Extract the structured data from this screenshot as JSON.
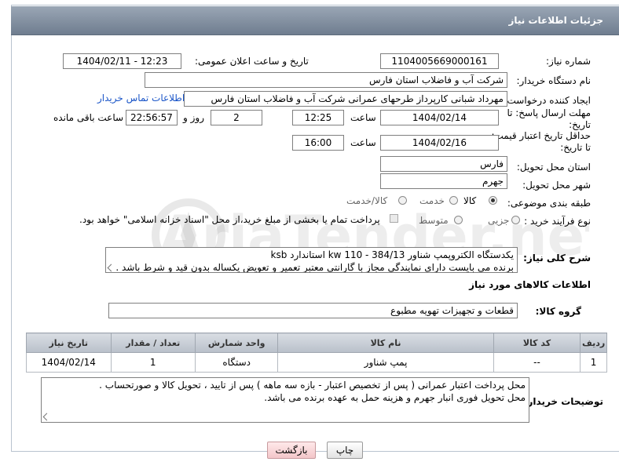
{
  "header": {
    "title": "جزئیات اطلاعات نیاز"
  },
  "fields": {
    "need_number": {
      "label": "شماره نیاز:",
      "value": "1104005669000161"
    },
    "announce_datetime": {
      "label": "تاریخ و ساعت اعلان عمومی:",
      "value": "1404/02/11 - 12:23"
    },
    "buyer_org": {
      "label": "نام دستگاه خریدار:",
      "value": "شرکت آب و فاضلاب استان فارس"
    },
    "requester": {
      "label": "ایجاد کننده درخواست:",
      "value": "مهرداد شبانی کارپرداز طرحهای عمرانی  شرکت آب و فاضلاب استان فارس",
      "contact_link": "اطلاعات تماس خریدار"
    },
    "reply_deadline": {
      "label_line1": "مهلت ارسال پاسخ: تا",
      "label_line2": "تاریخ:",
      "date": "1404/02/14",
      "time_label": "ساعت",
      "time": "12:25",
      "days": "2",
      "days_label": "روز و",
      "remaining": "22:56:57",
      "remaining_label": "ساعت باقی مانده"
    },
    "price_validity": {
      "label_line1": "حداقل تاریخ اعتبار قیمت:",
      "label_line2": "تا تاریخ:",
      "date": "1404/02/16",
      "time_label": "ساعت",
      "time": "16:00"
    },
    "delivery_province": {
      "label": "استان محل تحویل:",
      "value": "فارس"
    },
    "delivery_city": {
      "label": "شهر محل تحویل:",
      "value": "جهرم"
    },
    "category": {
      "label": "طبقه بندی موضوعی:",
      "options": [
        "کالا",
        "خدمت",
        "کالا/خدمت"
      ],
      "selected": "کالا"
    },
    "purchase_type": {
      "label": "نوع فرآیند خرید :",
      "options": [
        "جزیی",
        "متوسط"
      ],
      "payment_note": "پرداخت تمام یا بخشی از مبلغ خرید،از محل \"اسناد خزانه اسلامی\" خواهد بود."
    },
    "description": {
      "label": "شرح کلی نیاز:",
      "line1": "یکدستگاه الکتروپمپ شناور kw 110 - 384/13 استاندارد ksb",
      "line2": "برنده می بایست دارای نمایندگی مجاز با گارانتی معتبر تعمیر و تعویض یکساله بدون قید و شرط باشد ."
    }
  },
  "goods_info": {
    "section_title": "اطلاعات کالاهای مورد نیاز",
    "group_label": "گروه کالا:",
    "group_value": "قطعات و تجهیزات تهویه مطبوع",
    "columns": [
      "ردیف",
      "کد کالا",
      "نام کالا",
      "واحد شمارش",
      "تعداد / مقدار",
      "تاریخ نیاز"
    ],
    "rows": [
      {
        "row": "1",
        "code": "--",
        "name": "پمپ شناور",
        "unit": "دستگاه",
        "qty": "1",
        "date": "1404/02/14"
      }
    ]
  },
  "buyer_notes": {
    "label": "توضیحات خریدار:",
    "line1": "محل پرداخت اعتبار عمرانی  ( پس از تخصیص اعتبار  - بازه سه ماهه ) پس از تایید ، تحویل کالا و صورتحساب .",
    "line2": "محل تحویل فوری انبار جهرم و هزینه حمل به عهده برنده می باشد."
  },
  "buttons": {
    "print": "چاپ",
    "back": "بازگشت"
  },
  "watermark": {
    "text": "AriaTender.net"
  }
}
